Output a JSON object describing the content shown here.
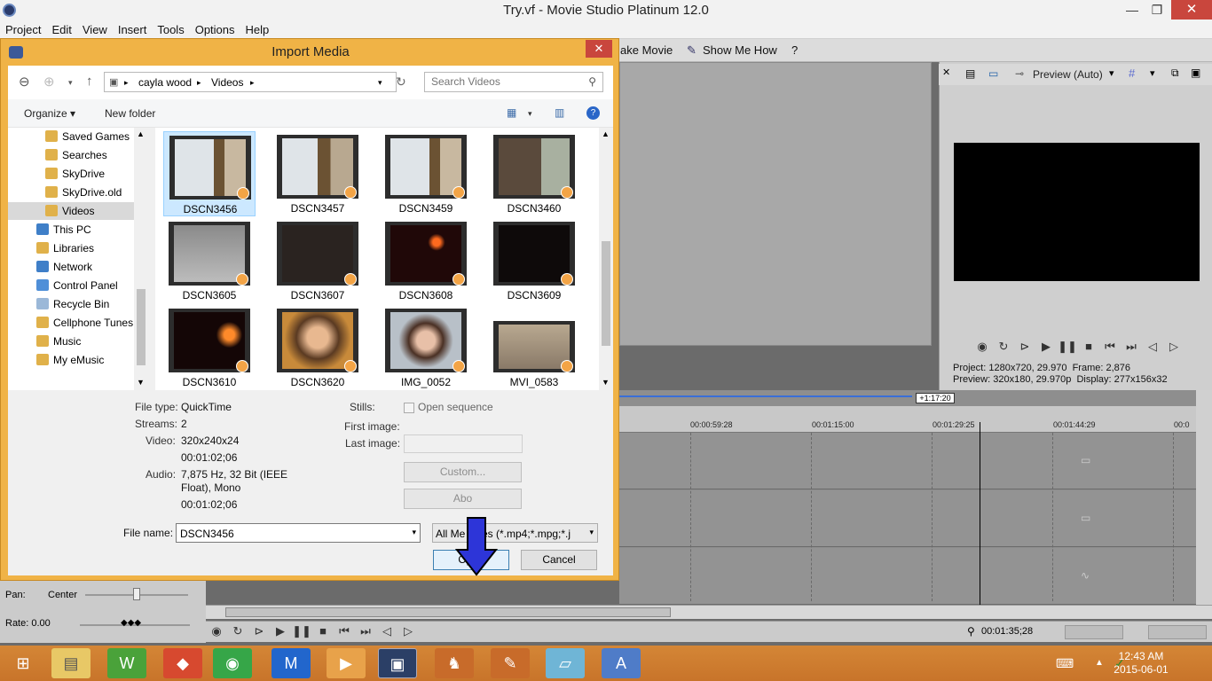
{
  "app": {
    "title": "Try.vf - Movie Studio Platinum 12.0",
    "min_glyph": "—",
    "max_glyph": "❐",
    "close_glyph": "✕",
    "menu": [
      "Project",
      "Edit",
      "View",
      "Insert",
      "Tools",
      "Options",
      "Help"
    ],
    "toolbar": {
      "make_movie": "ake Movie",
      "show_me_how": "Show Me How"
    },
    "preview_label": "Preview (Auto)",
    "project_info": {
      "line1_label": "Project:",
      "line1_value": "1280x720, 29.970",
      "frame_label": "Frame:",
      "frame_value": "2,876",
      "line2_label": "Preview:",
      "line2_value": "320x180, 29.970p",
      "display_label": "Display:",
      "display_value": "277x156x32"
    },
    "timeline": {
      "badge": "+1:17:20",
      "ticks": [
        "00:00:59:28",
        "00:01:15:00",
        "00:01:29:25",
        "00:01:44:29",
        "00:0"
      ],
      "current_time": "00:01:35;28"
    },
    "lower_left": {
      "pan_label": "Pan:",
      "pan_value": "Center",
      "rate_label": "Rate: 0.00"
    }
  },
  "taskbar": {
    "time": "12:43 AM",
    "date": "2015-06-01"
  },
  "dialog": {
    "title": "Import Media",
    "close_glyph": "✕",
    "breadcrumb": [
      "cayla wood",
      "Videos"
    ],
    "search_placeholder": "Search Videos",
    "organize_label": "Organize ▾",
    "new_folder_label": "New folder",
    "nav_items": [
      {
        "label": "Saved Games"
      },
      {
        "label": "Searches"
      },
      {
        "label": "SkyDrive"
      },
      {
        "label": "SkyDrive.old"
      },
      {
        "label": "Videos"
      },
      {
        "label": "This PC"
      },
      {
        "label": "Libraries"
      },
      {
        "label": "Network"
      },
      {
        "label": "Control Panel"
      },
      {
        "label": "Recycle Bin"
      },
      {
        "label": "Cellphone Tunes"
      },
      {
        "label": "Music"
      },
      {
        "label": "My eMusic"
      }
    ],
    "files": [
      "DSCN3456",
      "DSCN3457",
      "DSCN3459",
      "DSCN3460",
      "DSCN3605",
      "DSCN3607",
      "DSCN3608",
      "DSCN3609",
      "DSCN3610",
      "DSCN3620",
      "IMG_0052",
      "MVI_0583"
    ],
    "details": {
      "file_type_label": "File type:",
      "file_type": "QuickTime",
      "streams_label": "Streams:",
      "streams": "2",
      "video_label": "Video:",
      "video": "320x240x24",
      "video_dur": "00:01:02;06",
      "audio_label": "Audio:",
      "audio": "7,875 Hz, 32 Bit (IEEE",
      "audio2": "Float), Mono",
      "audio_dur": "00:01:02;06",
      "stills_label": "Stills:",
      "open_sequence": "Open sequence",
      "first_image_label": "First image:",
      "last_image_label": "Last image:",
      "custom_label": "Custom...",
      "about_label": "Abo"
    },
    "file_name_label": "File name:",
    "file_name_value": "DSCN3456",
    "file_type_filter": "All Me    iles (*.mp4;*.mpg;*.j",
    "open_label": "Open",
    "cancel_label": "Cancel"
  }
}
